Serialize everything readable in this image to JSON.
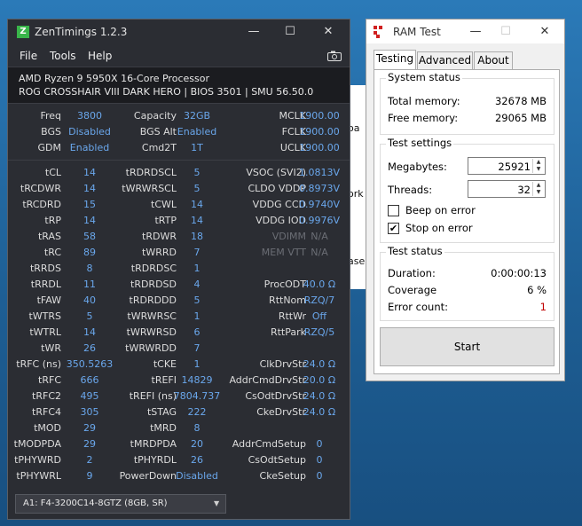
{
  "zentimings": {
    "title": "ZenTimings 1.2.3",
    "logo_letter": "Z",
    "menu": [
      "File",
      "Tools",
      "Help"
    ],
    "cpu": "AMD Ryzen 9 5950X 16-Core Processor",
    "board": "ROG CROSSHAIR VIII DARK HERO | BIOS 3501 | SMU 56.50.0",
    "top_rows": [
      [
        "Freq",
        "3800",
        "Capacity",
        "32GB",
        "MCLK",
        "1900.00"
      ],
      [
        "BGS",
        "Disabled",
        "BGS Alt",
        "Enabled",
        "FCLK",
        "1900.00"
      ],
      [
        "GDM",
        "Enabled",
        "Cmd2T",
        "1T",
        "UCLK",
        "1900.00"
      ]
    ],
    "timing_rows": [
      [
        "tCL",
        "14",
        "tRDRDSCL",
        "5",
        "VSOC (SVI2)",
        "1.0813V"
      ],
      [
        "tRCDWR",
        "14",
        "tWRWRSCL",
        "5",
        "CLDO VDDP",
        "0.8973V"
      ],
      [
        "tRCDRD",
        "15",
        "tCWL",
        "14",
        "VDDG CCD",
        "0.9740V"
      ],
      [
        "tRP",
        "14",
        "tRTP",
        "14",
        "VDDG IOD",
        "0.9976V"
      ],
      [
        "tRAS",
        "58",
        "tRDWR",
        "18",
        "VDIMM",
        "N/A"
      ],
      [
        "tRC",
        "89",
        "tWRRD",
        "7",
        "MEM VTT",
        "N/A"
      ],
      [
        "tRRDS",
        "8",
        "tRDRDSC",
        "1",
        "",
        ""
      ],
      [
        "tRRDL",
        "11",
        "tRDRDSD",
        "4",
        "ProcODT",
        "40.0 Ω"
      ],
      [
        "tFAW",
        "40",
        "tRDRDDD",
        "5",
        "RttNom",
        "RZQ/7"
      ],
      [
        "tWTRS",
        "5",
        "tWRWRSC",
        "1",
        "RttWr",
        "Off"
      ],
      [
        "tWTRL",
        "14",
        "tWRWRSD",
        "6",
        "RttPark",
        "RZQ/5"
      ],
      [
        "tWR",
        "26",
        "tWRWRDD",
        "7",
        "",
        ""
      ],
      [
        "tRFC (ns)",
        "350.5263",
        "tCKE",
        "1",
        "ClkDrvStr",
        "24.0 Ω"
      ],
      [
        "tRFC",
        "666",
        "tREFI",
        "14829",
        "AddrCmdDrvStr",
        "20.0 Ω"
      ],
      [
        "tRFC2",
        "495",
        "tREFI (ns)",
        "7804.737",
        "CsOdtDrvStr",
        "24.0 Ω"
      ],
      [
        "tRFC4",
        "305",
        "tSTAG",
        "222",
        "CkeDrvStr",
        "24.0 Ω"
      ],
      [
        "tMOD",
        "29",
        "tMRD",
        "8",
        "",
        ""
      ],
      [
        "tMODPDA",
        "29",
        "tMRDPDA",
        "20",
        "AddrCmdSetup",
        "0"
      ],
      [
        "tPHYWRD",
        "2",
        "tPHYRDL",
        "26",
        "CsOdtSetup",
        "0"
      ],
      [
        "tPHYWRL",
        "9",
        "PowerDown",
        "Disabled",
        "CkeSetup",
        "0"
      ]
    ],
    "dimm_selected": "A1: F4-3200C14-8GTZ (8GB, SR)"
  },
  "desktop_peek": {
    "a": "oa",
    "b": "ork",
    "c": "ase"
  },
  "ramtest": {
    "title": "RAM Test",
    "tabs": [
      "Testing",
      "Advanced",
      "About"
    ],
    "system_status": {
      "heading": "System status",
      "total_label": "Total memory:",
      "total_value": "32678 MB",
      "free_label": "Free memory:",
      "free_value": "29065 MB"
    },
    "test_settings": {
      "heading": "Test settings",
      "megabytes_label": "Megabytes:",
      "megabytes_value": "25921",
      "threads_label": "Threads:",
      "threads_value": "32",
      "beep_label": "Beep on error",
      "beep_checked": false,
      "stop_label": "Stop on error",
      "stop_checked": true
    },
    "test_status": {
      "heading": "Test status",
      "duration_label": "Duration:",
      "duration_value": "0:00:00:13",
      "coverage_label": "Coverage",
      "coverage_value": "6 %",
      "errors_label": "Error count:",
      "errors_value": "1"
    },
    "start_label": "Start"
  },
  "colors": {
    "value_blue": "#6aa7ec",
    "error_red": "#c00000",
    "zen_bg": "#2b2d33"
  }
}
